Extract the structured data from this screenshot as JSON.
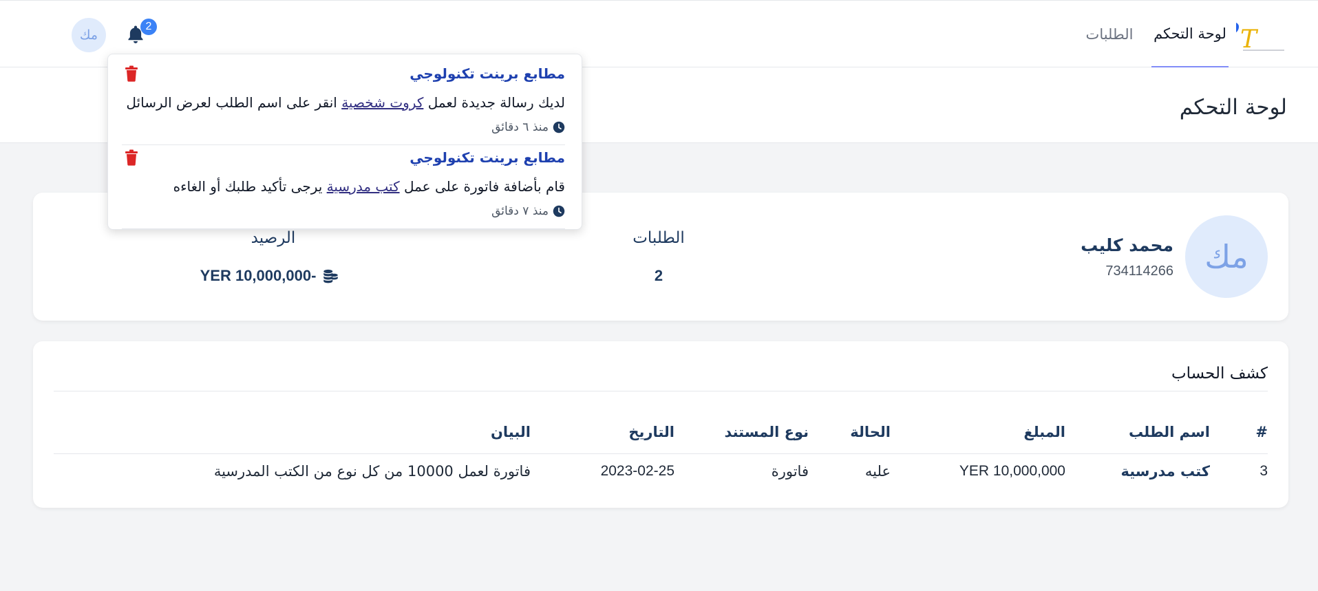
{
  "navbar": {
    "logo_text": "PT",
    "tabs": [
      {
        "label": "لوحة التحكم",
        "active": true
      },
      {
        "label": "الطلبات",
        "active": false
      }
    ],
    "notification_count": "2",
    "avatar_initials": "مك",
    "icons": [
      "bell-icon",
      "avatar"
    ]
  },
  "page": {
    "title": "لوحة التحكم"
  },
  "profile": {
    "initials": "مك",
    "name": "محمد كليب",
    "phone": "734114266",
    "orders_label": "الطلبات",
    "orders_value": "2",
    "balance_label": "الرصيد",
    "balance_value": "YER 10,000,000-"
  },
  "statement": {
    "title": "كشف الحساب",
    "columns": [
      "#",
      "اسم الطلب",
      "المبلغ",
      "الحالة",
      "نوع المستند",
      "التاريخ",
      "البيان"
    ],
    "rows": [
      {
        "num": "3",
        "name": "كتب مدرسية",
        "amount": "YER 10,000,000",
        "status": "عليه",
        "type": "فاتورة",
        "date": "2023-02-25",
        "desc": "فاتورة لعمل 10000 من كل نوع من الكتب المدرسية"
      }
    ]
  },
  "notifications": [
    {
      "title": "مطابع برينت تكنولوجي",
      "text_before": "لديك رسالة جديدة لعمل",
      "link": "كروت شخصية",
      "text_after": "انقر على اسم الطلب لعرض الرسائل",
      "time": "منذ ٦ دقائق"
    },
    {
      "title": "مطابع برينت تكنولوجي",
      "text_before": "قام بأضافة فاتورة على عمل",
      "link": "كتب مدرسية",
      "text_after": "يرجى تأكيد طلبك أو الغاءه",
      "time": "منذ ٧ دقائق"
    }
  ],
  "colors": {
    "primary_dark": "#1e3a5f",
    "badge": "#3b82f6",
    "trash": "#dc2626",
    "active_tab_underline": "#818cf8"
  }
}
